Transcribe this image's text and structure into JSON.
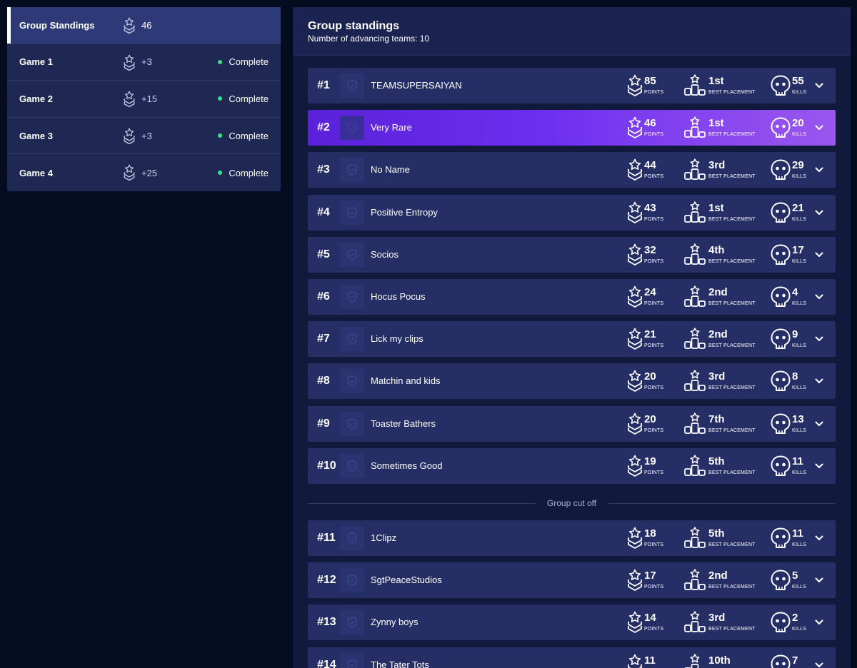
{
  "sidebar": {
    "items": [
      {
        "label": "Group Standings",
        "points": "46",
        "status": ""
      },
      {
        "label": "Game 1",
        "points": "+3",
        "status": "Complete"
      },
      {
        "label": "Game 2",
        "points": "+15",
        "status": "Complete"
      },
      {
        "label": "Game 3",
        "points": "+3",
        "status": "Complete"
      },
      {
        "label": "Game 4",
        "points": "+25",
        "status": "Complete"
      }
    ],
    "active_index": 0
  },
  "main": {
    "title": "Group standings",
    "subtitle": "Number of advancing teams: 10",
    "labels": {
      "points": "POINTS",
      "placement": "BEST PLACEMENT",
      "kills": "KILLS"
    },
    "cutoff_label": "Group cut off",
    "cutoff_after": 10,
    "highlight_rank": 2,
    "teams": [
      {
        "rank": "#1",
        "name": "TEAMSUPERSAIYAN",
        "points": "85",
        "placement": "1st",
        "kills": "55"
      },
      {
        "rank": "#2",
        "name": "Very Rare",
        "points": "46",
        "placement": "1st",
        "kills": "20"
      },
      {
        "rank": "#3",
        "name": "No Name",
        "points": "44",
        "placement": "3rd",
        "kills": "29"
      },
      {
        "rank": "#4",
        "name": "Positive Entropy",
        "points": "43",
        "placement": "1st",
        "kills": "21"
      },
      {
        "rank": "#5",
        "name": "Socios",
        "points": "32",
        "placement": "4th",
        "kills": "17"
      },
      {
        "rank": "#6",
        "name": "Hocus Pocus",
        "points": "24",
        "placement": "2nd",
        "kills": "4"
      },
      {
        "rank": "#7",
        "name": "Lick my clips",
        "points": "21",
        "placement": "2nd",
        "kills": "9"
      },
      {
        "rank": "#8",
        "name": "Matchin and kids",
        "points": "20",
        "placement": "3rd",
        "kills": "8"
      },
      {
        "rank": "#9",
        "name": "Toaster Bathers",
        "points": "20",
        "placement": "7th",
        "kills": "13"
      },
      {
        "rank": "#10",
        "name": "Sometimes Good",
        "points": "19",
        "placement": "5th",
        "kills": "11"
      },
      {
        "rank": "#11",
        "name": "1Clipz",
        "points": "18",
        "placement": "5th",
        "kills": "11"
      },
      {
        "rank": "#12",
        "name": "SgtPeaceStudios",
        "points": "17",
        "placement": "2nd",
        "kills": "5"
      },
      {
        "rank": "#13",
        "name": "Zynny boys",
        "points": "14",
        "placement": "3rd",
        "kills": "2"
      },
      {
        "rank": "#14",
        "name": "The Tater Tots",
        "points": "11",
        "placement": "10th",
        "kills": "7"
      }
    ]
  },
  "icons": {
    "points": "chevron-rank-star-icon",
    "placement": "podium-star-icon",
    "kills": "skull-icon",
    "expand": "chevron-down-icon",
    "logo": "shield-icon"
  },
  "colors": {
    "background": "#050c1f",
    "row": "#252f66",
    "highlight_start": "#5b21d9",
    "highlight_end": "#9a57ee",
    "status_complete": "#2ee58e"
  }
}
